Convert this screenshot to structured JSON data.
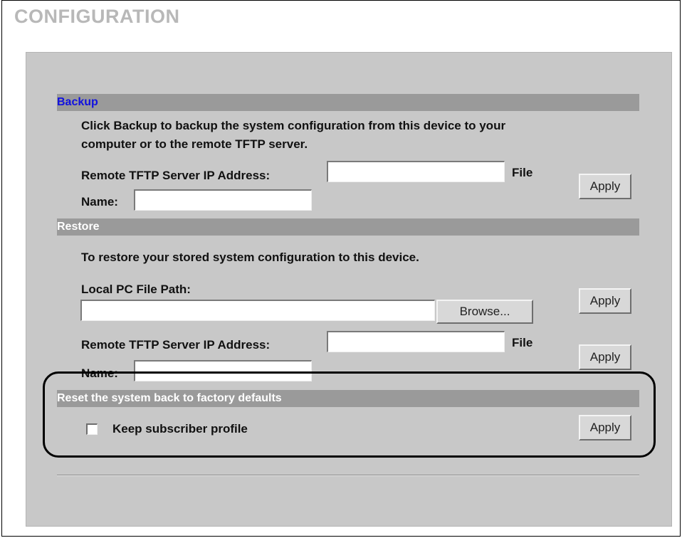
{
  "page": {
    "title": "CONFIGURATION"
  },
  "backup": {
    "heading": "Backup",
    "description_line1": "Click Backup to backup the system configuration from this device to your",
    "description_line2": "computer or to the remote TFTP server.",
    "server_label": "Remote TFTP Server IP Address:",
    "server_value": "",
    "file_label": "File",
    "name_label": "Name:",
    "name_value": "",
    "apply_label": "Apply"
  },
  "restore": {
    "heading": "Restore",
    "description": "To restore your stored system configuration to this device.",
    "local_path_label": "Local PC File Path:",
    "local_path_value": "",
    "browse_label": "Browse...",
    "local_apply_label": "Apply",
    "server_label": "Remote TFTP Server IP Address:",
    "server_value": "",
    "file_label": "File",
    "name_label": "Name:",
    "name_value": "",
    "remote_apply_label": "Apply"
  },
  "reset": {
    "heading": "Reset the system back to factory defaults",
    "keep_profile_label": "Keep subscriber profile",
    "keep_profile_checked": false,
    "apply_label": "Apply"
  },
  "colors": {
    "panel_background": "#c8c8c8",
    "section_bar": "#9a9a9a",
    "backup_heading": "#1010e0",
    "restore_heading": "#ffffff",
    "reset_heading": "#ffffff",
    "title": "#b8b8b8"
  }
}
